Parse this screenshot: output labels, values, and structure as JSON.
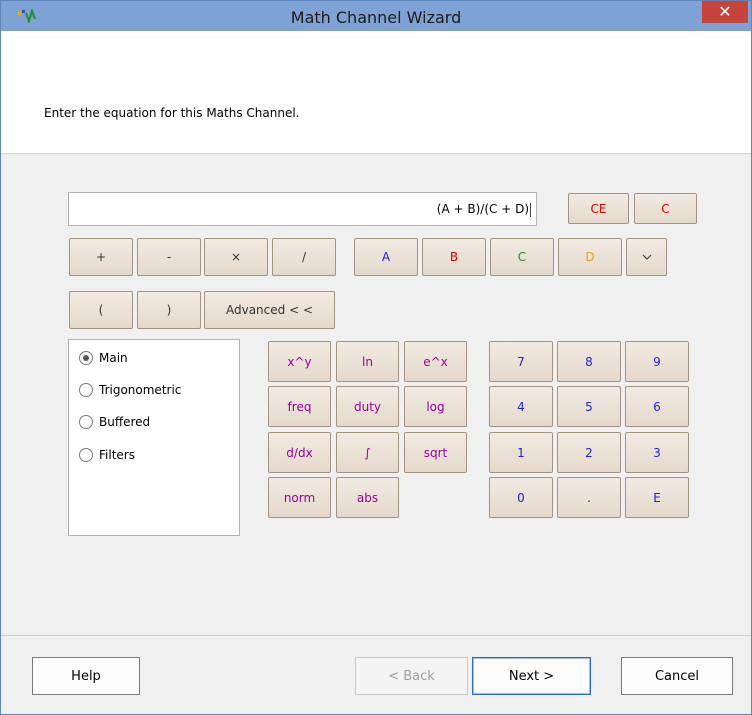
{
  "window": {
    "title": "Math Channel Wizard",
    "close_label": "✕"
  },
  "instruction": "Enter the equation for this Maths Channel.",
  "equation": {
    "value": "(A + B)/(C + D)"
  },
  "clear_buttons": {
    "ce": "CE",
    "c": "C"
  },
  "operators": {
    "plus": "+",
    "minus": "-",
    "times": "×",
    "divide": "/"
  },
  "channels": {
    "a": "A",
    "b": "B",
    "c": "C",
    "d": "D",
    "more": "⌄"
  },
  "parens": {
    "open": "(",
    "close": ")"
  },
  "advanced_label": "Advanced < <",
  "categories": [
    {
      "label": "Main",
      "checked": true
    },
    {
      "label": "Trigonometric",
      "checked": false
    },
    {
      "label": "Buffered",
      "checked": false
    },
    {
      "label": "Filters",
      "checked": false
    }
  ],
  "functions": {
    "pow": "x^y",
    "ln": "ln",
    "exp": "e^x",
    "freq": "freq",
    "duty": "duty",
    "log": "log",
    "ddx": "d/dx",
    "integral": "∫",
    "sqrt": "sqrt",
    "norm": "norm",
    "abs": "abs"
  },
  "keypad": {
    "k7": "7",
    "k8": "8",
    "k9": "9",
    "k4": "4",
    "k5": "5",
    "k6": "6",
    "k1": "1",
    "k2": "2",
    "k3": "3",
    "k0": "0",
    "dot": ".",
    "e": "E"
  },
  "footer": {
    "help": "Help",
    "back": "< Back",
    "next": "Next >",
    "cancel": "Cancel"
  },
  "colors": {
    "titlebar": "#7fa2d4",
    "close": "#c7443c",
    "channel_a": "#1f1fe0",
    "channel_b": "#e00000",
    "channel_c": "#1f8f1f",
    "channel_d": "#e0a020",
    "function_text": "#990099"
  }
}
